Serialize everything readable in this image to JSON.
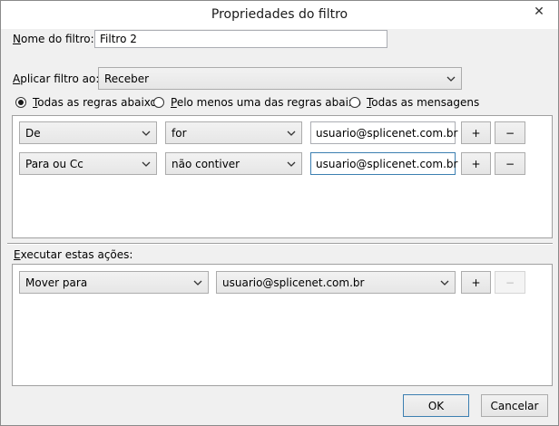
{
  "window": {
    "title": "Propriedades do filtro",
    "close_glyph": "✕"
  },
  "name_row": {
    "label_first": "N",
    "label_rest": "ome do filtro:",
    "value": "Filtro 2"
  },
  "apply_row": {
    "label_first": "A",
    "label_rest": "plicar filtro ao:",
    "value": "Receber"
  },
  "match_options": [
    {
      "accel": "T",
      "rest": "odas as regras abaixo",
      "checked": true
    },
    {
      "accel": "P",
      "rest": "elo menos uma das regras abaixo",
      "checked": false
    },
    {
      "accel": "T",
      "rest": "odas as mensagens",
      "checked": false
    }
  ],
  "rules": [
    {
      "field": "De",
      "operator": "for",
      "value": "usuario@splicenet.com.br",
      "add": "+",
      "remove": "−"
    },
    {
      "field": "Para ou Cc",
      "operator": "não contiver",
      "value": "usuario@splicenet.com.br",
      "add": "+",
      "remove": "−"
    }
  ],
  "actions_label": {
    "accel": "E",
    "rest": "xecutar estas ações:"
  },
  "actions": [
    {
      "action": "Mover para",
      "target": "usuario@splicenet.com.br",
      "add": "+",
      "remove": "−",
      "remove_disabled": true
    }
  ],
  "buttons": {
    "ok": "OK",
    "cancel": "Cancelar"
  },
  "colors": {
    "default_button_border": "#3c7fb1",
    "focused_field_border": "#3c7fb1"
  }
}
